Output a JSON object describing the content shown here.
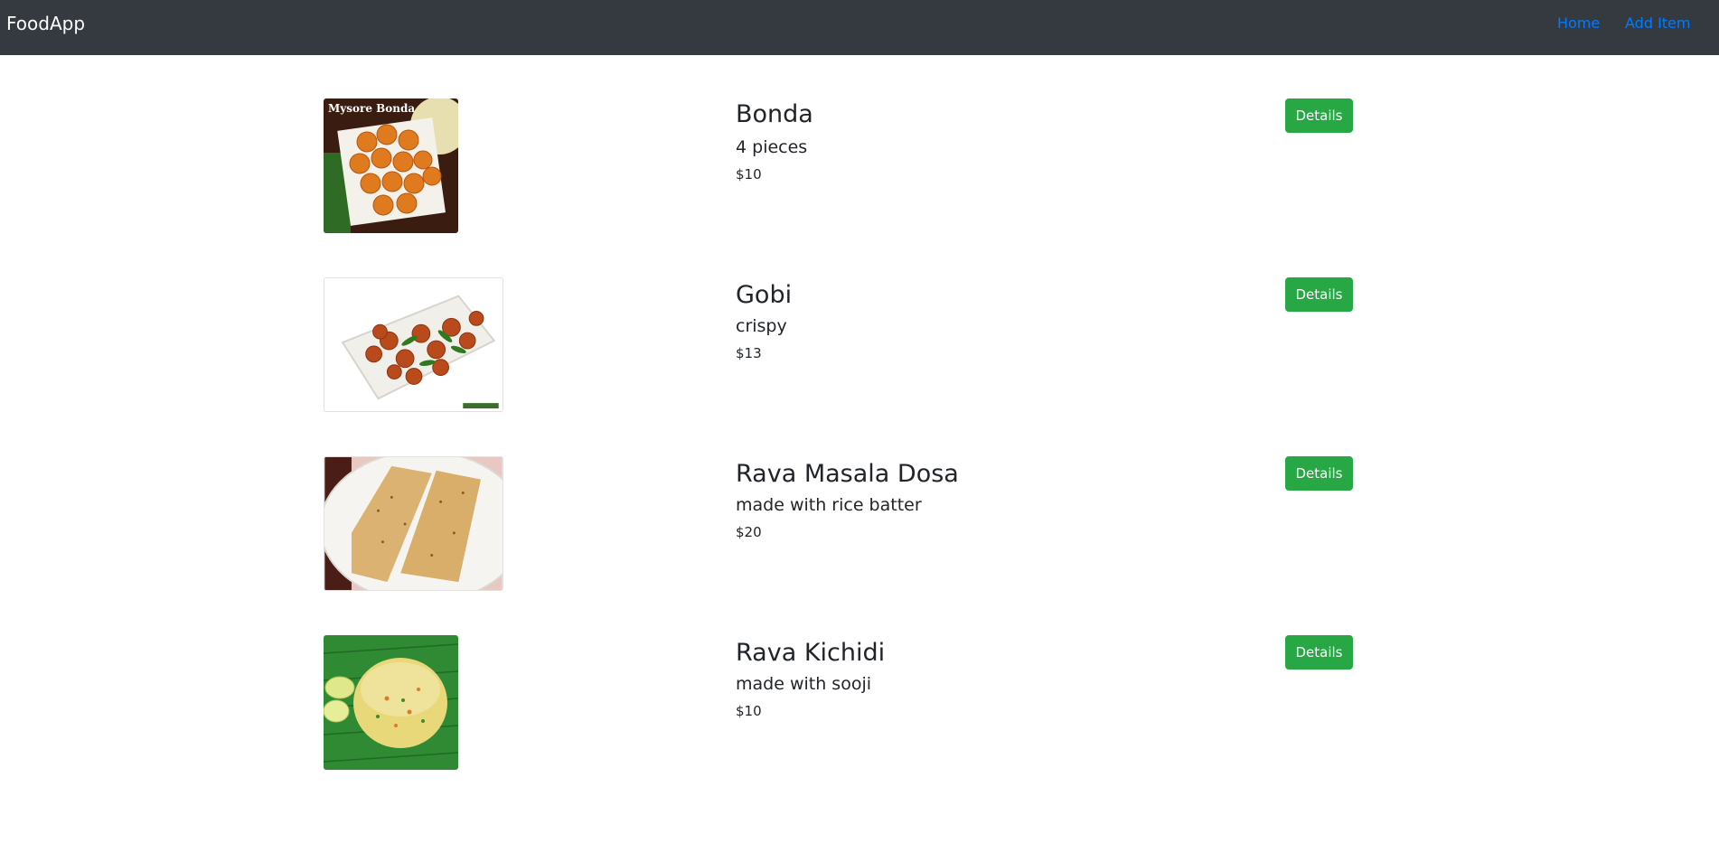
{
  "navbar": {
    "brand": "FoodApp",
    "links": [
      {
        "label": "Home"
      },
      {
        "label": "Add Item"
      }
    ],
    "background_color": "#343a40",
    "link_color": "#007bff"
  },
  "foods": [
    {
      "name": "Bonda",
      "description": "4 pieces",
      "price": "$10",
      "button_label": "Details",
      "image_caption": "Mysore Bonda"
    },
    {
      "name": "Gobi",
      "description": "crispy",
      "price": "$13",
      "button_label": "Details"
    },
    {
      "name": "Rava Masala Dosa",
      "description": "made with rice batter",
      "price": "$20",
      "button_label": "Details"
    },
    {
      "name": "Rava Kichidi",
      "description": "made with sooji",
      "price": "$10",
      "button_label": "Details"
    }
  ],
  "colors": {
    "button_green": "#28a745",
    "text": "#212529"
  }
}
